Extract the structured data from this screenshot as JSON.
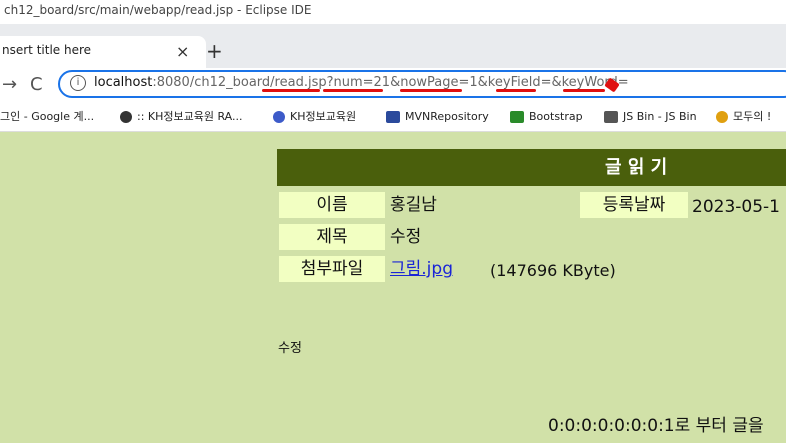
{
  "window": {
    "title": "ch12_board/src/main/webapp/read.jsp - Eclipse IDE"
  },
  "tab": {
    "title": "nsert title here",
    "close_icon": "×",
    "new_tab_icon": "+"
  },
  "nav": {
    "back_icon": "→",
    "reload_icon": "C"
  },
  "omnibox": {
    "url_host": "localhost",
    "url_rest": ":8080/ch12_board/read.jsp?num=21&nowPage=1&keyField=&keyWord="
  },
  "bookmarks": [
    {
      "label": "그인 - Google 계..."
    },
    {
      "label": ":: KH정보교육원 RA..."
    },
    {
      "label": "KH정보교육원"
    },
    {
      "label": "MVNRepository"
    },
    {
      "label": "Bootstrap"
    },
    {
      "label": "JS Bin - JS Bin"
    },
    {
      "label": "모두의 !"
    }
  ],
  "page": {
    "heading": "글 읽 기",
    "name_label": "이름",
    "name_value": "홍길남",
    "date_label": "등록날짜",
    "date_value": "2023-05-1",
    "subject_label": "제목",
    "subject_value": "수정",
    "file_label": "첨부파일",
    "file_name": "그림.jpg",
    "file_size": "(147696 KByte)",
    "content": "수정",
    "footer_text": "0:0:0:0:0:0:0:1로 부터 글을"
  },
  "colors": {
    "page_bg": "#d1e1a8",
    "header_bg": "#4a5f0c",
    "label_bg": "#f2ffc2",
    "annotation": "#e01010"
  }
}
